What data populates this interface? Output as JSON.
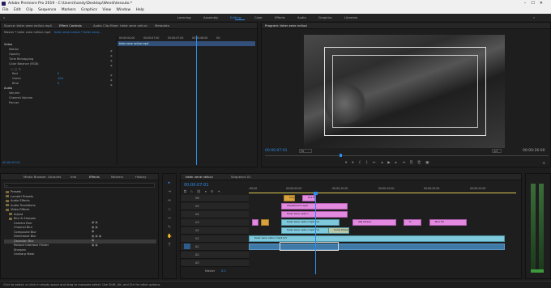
{
  "window": {
    "title": "Adobe Premiere Pro 2019 - C:\\Users\\handy\\Desktop\\Wendi\\tessuto.*"
  },
  "menu": [
    "File",
    "Edit",
    "Clip",
    "Sequence",
    "Markers",
    "Graphics",
    "View",
    "Window",
    "Help"
  ],
  "workspaces": [
    "Learning",
    "Assembly",
    "Editing",
    "Color",
    "Effects",
    "Audio",
    "Graphics",
    "Libraries"
  ],
  "workspace_active": "Editing",
  "source_panel": {
    "tabs": [
      "Source: tieler zene nelluci.mp4",
      "Effect Controls",
      "Audio Clip Mixer: tieler zene nelluci",
      "Metadata"
    ],
    "active_tab": "Effect Controls",
    "master_label": "Master * tieler zene nelluci.mp4",
    "sequence_label": "tieler zene nelluci * tieler zene...",
    "ruler": [
      "00:00:04:00",
      "00:00:07:00",
      "00:00:07:00",
      "00:00:08:00",
      "00:"
    ],
    "clip_label": "tieler zene nelluci.mp4",
    "sections": [
      "Video",
      "Motion",
      "Opacity",
      "Time Remapping",
      "Color Balance (RGB)",
      "Red",
      "Green",
      "Blue",
      "Audio",
      "Volume",
      "Channel Volume",
      "Panner"
    ],
    "values": {
      "red": "0",
      "green": "100",
      "blue": "0"
    },
    "timecode": "00:00:07:01"
  },
  "project_panel": {
    "tabs": [
      "Media Browser",
      "Libraries",
      "Info",
      "Effects",
      "Markers",
      "History"
    ],
    "active_tab": "Effects",
    "items": [
      "Presets",
      "Lumetri Presets",
      "Audio Effects",
      "Audio Transitions",
      "Video Effects",
      "Adjust",
      "Blur & Sharpen",
      "Camera Blur",
      "Channel Blur",
      "Compound Blur",
      "Directional Blur",
      "Gaussian Blur",
      "Reduce Interlace Flicker",
      "Sharpen",
      "Unsharp Mask"
    ]
  },
  "program_monitor": {
    "tab": "Program: tieler zene nelluci",
    "timecode": "00:00:07:01",
    "fit": "Fit",
    "quality": "1/2",
    "duration": "00:00:26:00"
  },
  "timeline": {
    "tabs": [
      "tieler zene nelluci",
      "Sequence 01"
    ],
    "timecode": "00:00:07:01",
    "ruler": [
      ":00:00",
      "00:00:05:00",
      "00:00:10:00",
      "00:00:15:00",
      "00:00:20:00",
      "00:00:25:00"
    ],
    "tracks": [
      "V6",
      "V5",
      "V4",
      "V3",
      "V2",
      "V1",
      "A1",
      "A2",
      "A3"
    ],
    "master_label": "Master",
    "master_value": "0.0",
    "clips": [
      {
        "label": "Crop fit",
        "color": "#d8a33c"
      },
      {
        "label": "Gra fit",
        "color": "#e38ae0"
      },
      {
        "label": "Adjustment Layer",
        "color": "#e38ae0"
      },
      {
        "label": "tieler zene nelluci",
        "color": "#e38ae0"
      },
      {
        "label": "tieler zene nelluci.mp4 [V]",
        "color": "#7ec9db"
      },
      {
        "label": "tieler zene nelluci.mp4 [V]",
        "color": "#7ec9db"
      },
      {
        "label": "ADJ Mosaic",
        "color": "#e38ae0"
      },
      {
        "label": "fx",
        "color": "#e38ae0"
      },
      {
        "label": "Blur fill",
        "color": "#e38ae0"
      },
      {
        "label": "Cross Dissolve",
        "color": "#7ec9db"
      },
      {
        "label": "tieler zene nelluci.mp4 [V]",
        "color": "#7ec9db"
      }
    ]
  },
  "statusbar": "Click to select, or click in empty space and drag to marquee select. Use Shift, Alt, and Ctrl for other options."
}
